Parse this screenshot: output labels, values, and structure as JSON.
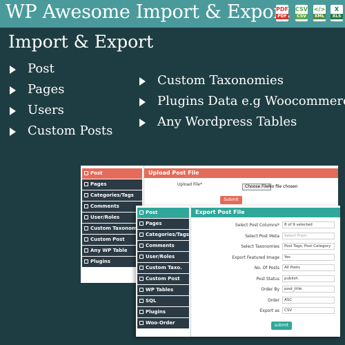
{
  "header": {
    "title": "WP Awesome Import & Export",
    "file_icons": [
      {
        "name": "pdf-file-icon",
        "glyph": "PDF",
        "band": "PDF",
        "color": "#d9382f"
      },
      {
        "name": "csv-file-icon",
        "glyph": "CSV",
        "band": "CSV",
        "color": "#5aa848"
      },
      {
        "name": "xml-file-icon",
        "glyph": "</>",
        "band": "XML",
        "color": "#4d8a3a"
      },
      {
        "name": "excel-file-icon",
        "glyph": "X",
        "band": "XLS",
        "color": "#1f7a3a"
      }
    ]
  },
  "heading": "Import & Export",
  "features_left": [
    "Post",
    "Pages",
    "Users",
    "Custom Posts"
  ],
  "features_right": [
    "Custom Taxonomies",
    "Plugins Data e.g Woocommerce",
    "Any Wordpress Tables"
  ],
  "upload_panel": {
    "title": "Upload Post File",
    "menu": [
      "Post",
      "Pages",
      "Categories/Tags",
      "Comments",
      "User/Roles",
      "Custom Taxonomies",
      "Custom Post",
      "Any WP Table",
      "Plugins"
    ],
    "file_label": "Upload File*",
    "choose_button": "Choose File",
    "no_file": "No file chosen",
    "submit": "Submit"
  },
  "export_panel": {
    "title": "Export Post File",
    "menu": [
      "Post",
      "Pages",
      "Categories/Tags",
      "Comments",
      "User/Roles",
      "Custom Taxo.",
      "Custom Post",
      "WP Tables",
      "SQL",
      "Plugins",
      "Woo-Order"
    ],
    "fields": [
      {
        "label": "Select Post Columns*",
        "value": "8 of 9 selected",
        "placeholder": false
      },
      {
        "label": "Select Post Meta",
        "value": "Select From",
        "placeholder": true
      },
      {
        "label": "Select Taxonomies",
        "value": "Post Tags, Post Category",
        "placeholder": false
      },
      {
        "label": "Export Featured Image",
        "value": "Yes",
        "placeholder": false
      },
      {
        "label": "No. Of Posts",
        "value": "All Posts",
        "placeholder": false
      },
      {
        "label": "Post Status",
        "value": "publish",
        "placeholder": false
      },
      {
        "label": "Order By",
        "value": "post_title",
        "placeholder": false
      },
      {
        "label": "Order",
        "value": "ASC",
        "placeholder": false
      },
      {
        "label": "Export as",
        "value": "CSV",
        "placeholder": false
      }
    ],
    "submit": "submit"
  },
  "colors": {
    "background": "#1e3d42",
    "title_bar": "#4a9a9c",
    "menu_item": "#2b3a44",
    "upload_accent": "#e56b5a",
    "export_accent": "#2fa79a"
  }
}
